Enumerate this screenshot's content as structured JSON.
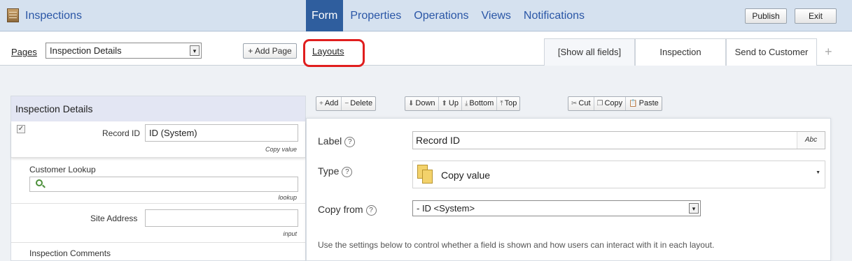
{
  "header": {
    "app_title": "Inspections",
    "nav": [
      "Form",
      "Properties",
      "Operations",
      "Views",
      "Notifications"
    ],
    "active_nav": "Form",
    "publish_label": "Publish",
    "exit_label": "Exit"
  },
  "pages": {
    "label": "Pages",
    "selected": "Inspection Details",
    "add_label": "+ Add Page"
  },
  "layouts": {
    "link_label": "Layouts",
    "tabs": [
      "[Show all fields]",
      "Inspection",
      "Send to Customer"
    ],
    "active_tab": "[Show all fields]",
    "add_tab": "+"
  },
  "form": {
    "section_title": "Inspection Details",
    "fields": [
      {
        "label": "Record ID",
        "value": "ID (System)",
        "type": "Copy value",
        "selected": true
      },
      {
        "label": "Customer Lookup",
        "value": "",
        "type": "lookup"
      },
      {
        "label": "Site Address",
        "value": "",
        "type": "input"
      },
      {
        "label": "Inspection Comments",
        "value": "",
        "type": ""
      }
    ]
  },
  "toolbar": {
    "add": "Add",
    "delete": "Delete",
    "down": "Down",
    "up": "Up",
    "bottom": "Bottom",
    "top": "Top",
    "cut": "Cut",
    "copy": "Copy",
    "paste": "Paste"
  },
  "properties": {
    "label_caption": "Label",
    "label_value": "Record ID",
    "abc": "Abc",
    "type_caption": "Type",
    "type_value": "Copy value",
    "copy_from_caption": "Copy from",
    "copy_from_value": "- ID <System>",
    "help_text": "Use the settings below to control whether a field is shown and how users can interact with it in each layout."
  },
  "colors": {
    "nav_active": "#2f5e9e",
    "link_blue": "#2a56a6",
    "highlight": "#e01e1e",
    "header_bg": "#d5e1ef"
  }
}
